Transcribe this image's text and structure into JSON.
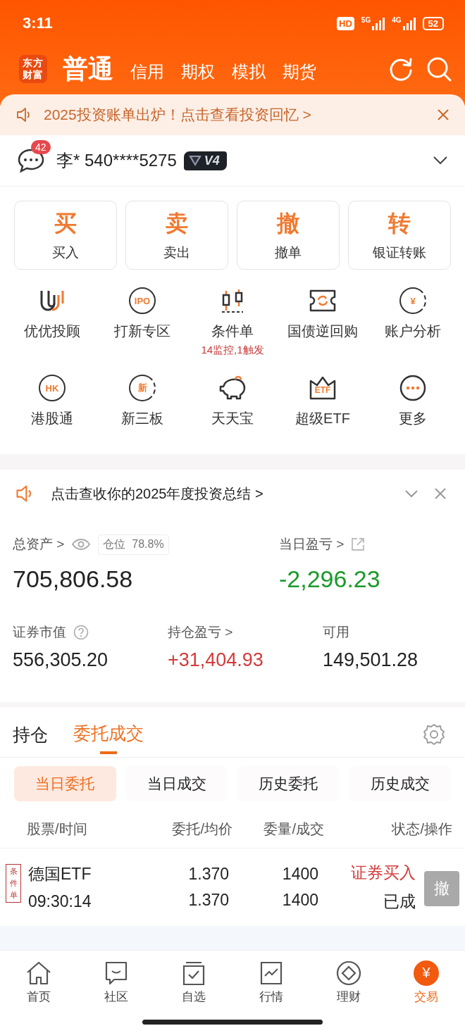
{
  "status_bar": {
    "time": "3:11",
    "hd": "HD",
    "net_1": "5G",
    "net_2": "4G",
    "battery": "52"
  },
  "header": {
    "logo": "东方财富",
    "tabs": [
      {
        "label": "普通",
        "selected": true
      },
      {
        "label": "信用",
        "selected": false
      },
      {
        "label": "期权",
        "selected": false
      },
      {
        "label": "模拟",
        "selected": false
      },
      {
        "label": "期货",
        "selected": false
      }
    ]
  },
  "banner": {
    "text": "2025投资账单出炉！点击查看投资回忆 >"
  },
  "account": {
    "message_count": "42",
    "name": "李* 540****5275",
    "level": "V4"
  },
  "trade_buttons": [
    {
      "glyph": "买",
      "label": "买入"
    },
    {
      "glyph": "卖",
      "label": "卖出"
    },
    {
      "glyph": "撤",
      "label": "撤单"
    },
    {
      "glyph": "转",
      "label": "银证转账"
    }
  ],
  "features": [
    {
      "label": "优优投顾"
    },
    {
      "label": "打新专区",
      "icon_text": "IPO"
    },
    {
      "label": "条件单",
      "note": "14监控,1触发"
    },
    {
      "label": "国债逆回购"
    },
    {
      "label": "账户分析",
      "icon_text": "¥"
    },
    {
      "label": "港股通",
      "icon_text": "HK"
    },
    {
      "label": "新三板",
      "icon_text": "新"
    },
    {
      "label": "天天宝"
    },
    {
      "label": "超级ETF",
      "icon_text": "ETF"
    },
    {
      "label": "更多"
    }
  ],
  "notice": {
    "text": "点击查收你的2025年度投资总结 >"
  },
  "assets": {
    "total_label": "总资产 >",
    "position_label": "仓位",
    "position_value": "78.8%",
    "total": "705,806.58",
    "daily": {
      "label": "当日盈亏 >",
      "value": "-2,296.23",
      "kind": "loss"
    },
    "stats": [
      {
        "label": "证券市值",
        "value": "556,305.20",
        "kind": "plain",
        "help": true
      },
      {
        "label": "持仓盈亏 >",
        "value": "+31,404.93",
        "kind": "gain"
      },
      {
        "label": "可用",
        "value": "149,501.28",
        "kind": "plain"
      }
    ]
  },
  "section_tabs": [
    {
      "label": "持仓",
      "selected": false
    },
    {
      "label": "委托成交",
      "selected": true
    }
  ],
  "sub_tabs": [
    {
      "label": "当日委托",
      "selected": true
    },
    {
      "label": "当日成交",
      "selected": false
    },
    {
      "label": "历史委托",
      "selected": false
    },
    {
      "label": "历史成交",
      "selected": false
    }
  ],
  "table": {
    "columns": [
      "股票/时间",
      "委托/均价",
      "委量/成交",
      "状态/操作"
    ],
    "rows": [
      {
        "tag": "条件单",
        "name": "德国ETF",
        "time": "09:30:14",
        "price": "1.370",
        "avg_price": "1.370",
        "quantity": "1400",
        "filled": "1400",
        "action": "证券买入",
        "status": "已成",
        "cancel": "撤",
        "cancel_disabled": true
      }
    ]
  },
  "bottom_nav": [
    {
      "label": "首页",
      "selected": false
    },
    {
      "label": "社区",
      "selected": false
    },
    {
      "label": "自选",
      "selected": false
    },
    {
      "label": "行情",
      "selected": false
    },
    {
      "label": "理财",
      "selected": false
    },
    {
      "label": "交易",
      "selected": true,
      "icon_text": "¥"
    }
  ]
}
